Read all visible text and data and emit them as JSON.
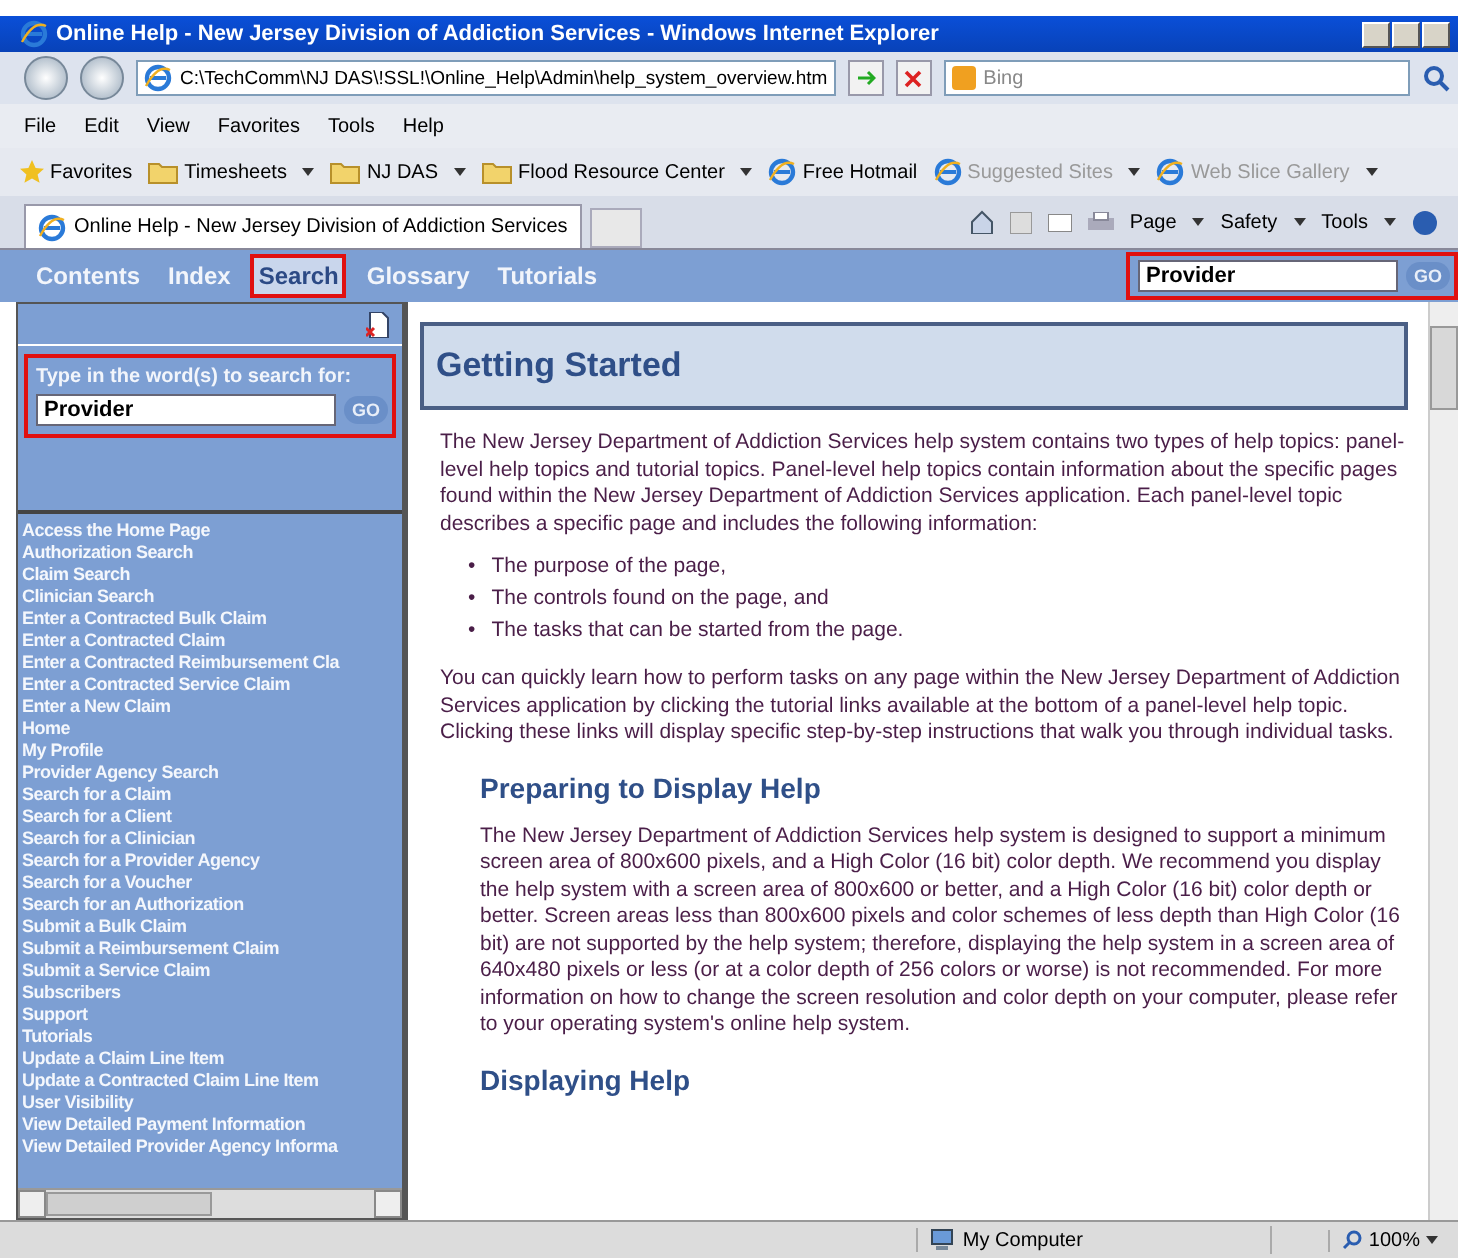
{
  "window": {
    "title": "Online Help - New Jersey Division of Addiction Services - Windows Internet Explorer"
  },
  "browser": {
    "address": "C:\\TechComm\\NJ DAS\\!SSL!\\Online_Help\\Admin\\help_system_overview.htm",
    "search_placeholder": "Bing",
    "menu": [
      "File",
      "Edit",
      "View",
      "Favorites",
      "Tools",
      "Help"
    ],
    "favorites_label": "Favorites",
    "favorites": [
      {
        "label": "Timesheets",
        "kind": "folder",
        "disabled": false
      },
      {
        "label": "NJ DAS",
        "kind": "folder",
        "disabled": false
      },
      {
        "label": "Flood Resource Center",
        "kind": "folder",
        "disabled": false
      },
      {
        "label": "Free Hotmail",
        "kind": "page",
        "disabled": false
      },
      {
        "label": "Suggested Sites",
        "kind": "page",
        "disabled": true
      },
      {
        "label": "Web Slice Gallery",
        "kind": "page",
        "disabled": true
      }
    ],
    "tab_title": "Online Help - New Jersey Division of Addiction Services",
    "commands": [
      "Page",
      "Safety",
      "Tools"
    ]
  },
  "help_nav": {
    "tabs": [
      {
        "label": "Contents",
        "selected": false
      },
      {
        "label": "Index",
        "selected": false
      },
      {
        "label": "Search",
        "selected": true
      },
      {
        "label": "Glossary",
        "selected": false
      },
      {
        "label": "Tutorials",
        "selected": false
      }
    ],
    "search": {
      "value": "Provider",
      "button": "GO",
      "highlighted": true
    }
  },
  "sidebar": {
    "search_label": "Type in the word(s) to search for:",
    "search_value": "Provider",
    "button": "GO",
    "highlighted": true,
    "results": [
      "Access the Home Page",
      "Authorization Search",
      "Claim Search",
      "Clinician Search",
      "Enter a Contracted Bulk Claim",
      "Enter a Contracted Claim",
      "Enter a Contracted Reimbursement Cla",
      "Enter a Contracted Service Claim",
      "Enter a New Claim",
      "Home",
      "My Profile",
      "Provider Agency Search",
      "Search for a Claim",
      "Search for a Client",
      "Search for a Clinician",
      "Search for a Provider Agency",
      "Search for a Voucher",
      "Search for an Authorization",
      "Submit a Bulk Claim",
      "Submit a Reimbursement Claim",
      "Submit a Service Claim",
      "Subscribers",
      "Support",
      "Tutorials",
      "Update a Claim Line Item",
      "Update a Contracted Claim Line Item",
      "User Visibility",
      "View Detailed Payment Information",
      "View Detailed Provider Agency Informa"
    ]
  },
  "content": {
    "title": "Getting Started",
    "intro": "The New Jersey Department of Addiction Services help system contains two types of help topics:  panel-level help topics and tutorial topics.  Panel-level help topics contain information about the specific pages found within the New Jersey Department of Addiction Services application.  Each panel-level topic describes a specific page and includes the following information:",
    "bullets": [
      {
        "marker": "•",
        "text": "The purpose of the page,"
      },
      {
        "marker": "•",
        "text": "The controls found on the page, and"
      },
      {
        "marker": "•",
        "text": "The tasks that can be started from the page."
      }
    ],
    "paragraph": "You can quickly learn how to perform tasks on any page within the New Jersey Department of Addiction Services application by clicking the tutorial links available at the bottom of a panel-level help topic.  Clicking these links will display specific step-by-step instructions that walk you through individual tasks.",
    "sections": [
      {
        "heading": "Preparing to Display Help",
        "text": "The New Jersey Department of Addiction Services help system is designed to support a minimum screen area of 800x600 pixels, and a High Color (16 bit) color depth.  We recommend you display the help system with a screen area of 800x600 or better, and a High Color (16 bit) color depth or better.  Screen areas less than 800x600 pixels and color schemes of less depth than High Color (16 bit) are not supported by the help system; therefore, displaying the help system in a screen area of 640x480 pixels or less (or at a color depth of 256 colors or worse) is not recommended.  For more information on how to change the screen resolution and color depth on your computer, please refer to your operating system's online help system."
      },
      {
        "heading": "Displaying Help"
      }
    ]
  },
  "status_bar": {
    "zone": "My Computer",
    "zoom": "100%"
  }
}
